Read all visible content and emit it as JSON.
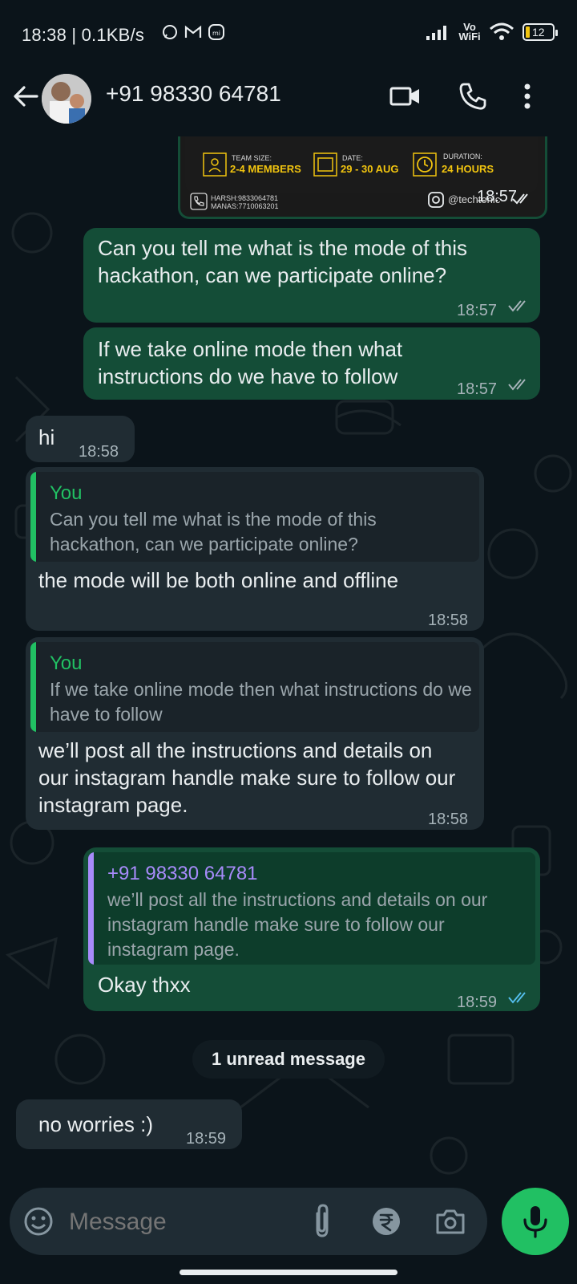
{
  "status_bar": {
    "time_speed": "18:38 | 0.1KB/s",
    "vowifi": "Vo WiFi",
    "battery": "12"
  },
  "header": {
    "contact": "+91 98330 64781"
  },
  "poster": {
    "team_size_label": "TEAM SIZE:",
    "team_size_value": "2-4 MEMBERS",
    "date_label": "DATE:",
    "date_value": "29 - 30 AUG",
    "duration_label": "DURATION:",
    "duration_value": "24 HOURS",
    "contact_1": "HARSH:9833064781",
    "contact_2": "MANAS:7710063201",
    "handle": "@techtonic",
    "time": "18:57"
  },
  "messages": [
    {
      "text": "Can you tell me what is the mode of this hackathon, can we participate online?",
      "time": "18:57"
    },
    {
      "text": "If we take online mode then what instructions do we have to follow",
      "time": "18:57"
    },
    {
      "text": "hi",
      "time": "18:58"
    },
    {
      "quote_author": "You",
      "quote_text": "Can you tell me what is the mode of this hackathon, can we participate online?",
      "text": "the mode will be both online and offline",
      "time": "18:58"
    },
    {
      "quote_author": "You",
      "quote_text": "If we take online mode then what instructions do we have to follow",
      "text": "we’ll post all the instructions and details on our instagram handle make sure to follow our instagram page.",
      "time": "18:58"
    },
    {
      "quote_author": "+91 98330 64781",
      "quote_text": "we’ll post all the instructions and details on our instagram handle make sure to follow our instagram page.",
      "text": "Okay thxx",
      "time": "18:59"
    },
    {
      "text": "no worries :)",
      "time": "18:59"
    }
  ],
  "unread_label": "1 unread message",
  "input": {
    "placeholder": "Message"
  },
  "colors": {
    "outgoing": "#144d37",
    "incoming": "#202c33",
    "accent_green": "#21c063",
    "quote_you": "#21c063",
    "quote_contact": "#a78bfa",
    "read_ticks": "#53bdeb"
  }
}
